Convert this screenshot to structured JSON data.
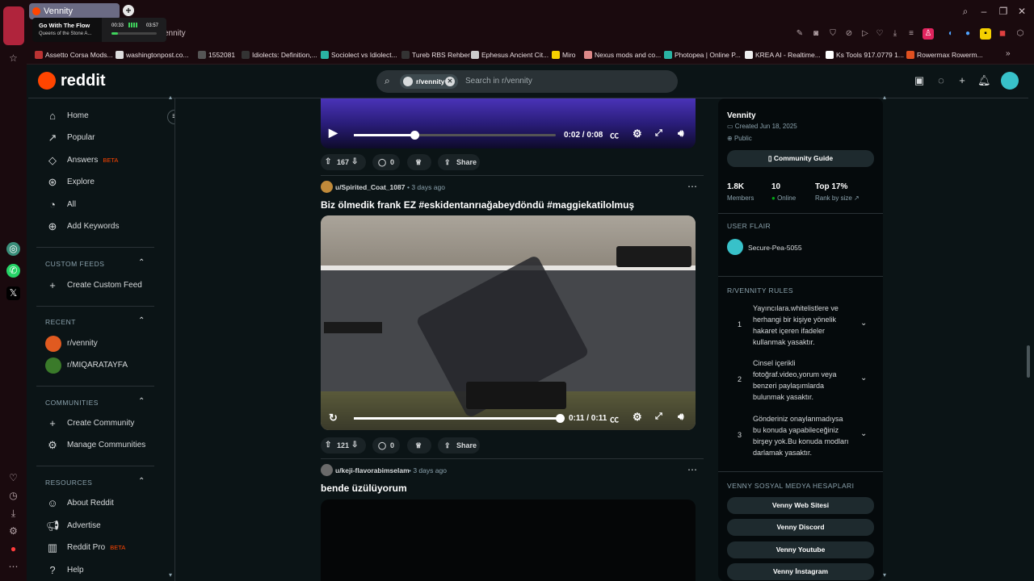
{
  "browser": {
    "active_tab": "Vennity",
    "url_fragment": "ennity",
    "media": {
      "title": "Go With The Flow",
      "artist": "Queens of the Stone A...",
      "time_current": "00:33",
      "time_total": "03:57"
    },
    "bookmarks": [
      "Assetto Corsa Mods...",
      "washingtonpost.co...",
      "1552081",
      "Idiolects: Definition,...",
      "Sociolect vs Idiolect...",
      "Tureb RBS Rehber",
      "Ephesus Ancient Cit...",
      "Miro",
      "Nexus mods and co...",
      "Photopea | Online P...",
      "KREA AI - Realtime...",
      "Ks Tools 917.0779 1...",
      "Rowermax Rowerm..."
    ]
  },
  "header": {
    "logo_text": "reddit",
    "search_chip": "r/vennity",
    "search_placeholder": "Search in r/vennity"
  },
  "sidebar": {
    "items": [
      {
        "label": "Home",
        "icon": "home-icon"
      },
      {
        "label": "Popular",
        "icon": "popular-icon"
      },
      {
        "label": "Answers",
        "icon": "answers-icon",
        "badge": "BETA"
      },
      {
        "label": "Explore",
        "icon": "explore-icon"
      },
      {
        "label": "All",
        "icon": "all-icon"
      },
      {
        "label": "Add Keywords",
        "icon": "keywords-icon"
      }
    ],
    "custom_feeds_title": "CUSTOM FEEDS",
    "create_custom_feed": "Create Custom Feed",
    "recent_title": "RECENT",
    "recent": [
      "r/vennity",
      "r/MIQARATAYFA"
    ],
    "communities_title": "COMMUNITIES",
    "create_community": "Create Community",
    "manage_communities": "Manage Communities",
    "resources_title": "RESOURCES",
    "resources": [
      {
        "label": "About Reddit",
        "badge": ""
      },
      {
        "label": "Advertise",
        "badge": ""
      },
      {
        "label": "Reddit Pro",
        "badge": "BETA"
      },
      {
        "label": "Help",
        "badge": ""
      }
    ]
  },
  "feed": {
    "video1": {
      "time": "0:02 / 0:08",
      "progress": 0.3,
      "upvotes": "167",
      "comments": "0",
      "share": "Share"
    },
    "post2": {
      "author": "u/Spirited_Coat_1087",
      "age": "• 3 days ago",
      "title": "Biz ölmedik frank EZ #eskidentanrıağabeydöndü #maggiekatilolmuş",
      "time": "0:11 / 0:11",
      "progress": 1.0,
      "upvotes": "121",
      "comments": "0",
      "share": "Share"
    },
    "post3": {
      "author": "u/keji-flavorabimselam",
      "age": "• 3 days ago",
      "title": "bende üzülüyorum"
    }
  },
  "community": {
    "name": "Vennity",
    "created": "Created Jun 18, 2025",
    "visibility": "Public",
    "guide_button": "Community Guide",
    "members_value": "1.8K",
    "members_label": "Members",
    "online_value": "10",
    "online_label": "Online",
    "rank_value": "Top 17%",
    "rank_label": "Rank by size",
    "flair_title": "USER FLAIR",
    "flair_user": "Secure-Pea-5055",
    "rules_title": "R/VENNITY RULES",
    "rules": [
      {
        "n": "1",
        "text": "Yayıncılara.whitelistlere ve herhangi bir kişiye yönelik hakaret içeren ifadeler kullanmak yasaktır."
      },
      {
        "n": "2",
        "text": "Cinsel içerikli fotoğraf.video,yorum veya benzeri paylaşımlarda bulunmak yasaktır."
      },
      {
        "n": "3",
        "text": "Gönderiniz onaylanmadıysa bu konuda yapabileceğiniz birşey yok.Bu konuda modları darlamak yasaktır."
      }
    ],
    "social_title": "VENNY SOSYAL MEDYA HESAPLARI",
    "social": [
      "Venny Web Sitesi",
      "Venny Discord",
      "Venny Youtube",
      "Venny İnstagram"
    ]
  },
  "colors": {
    "reddit_orange": "#ff4500",
    "bg": "#0b1416",
    "online_green": "#01a816"
  }
}
